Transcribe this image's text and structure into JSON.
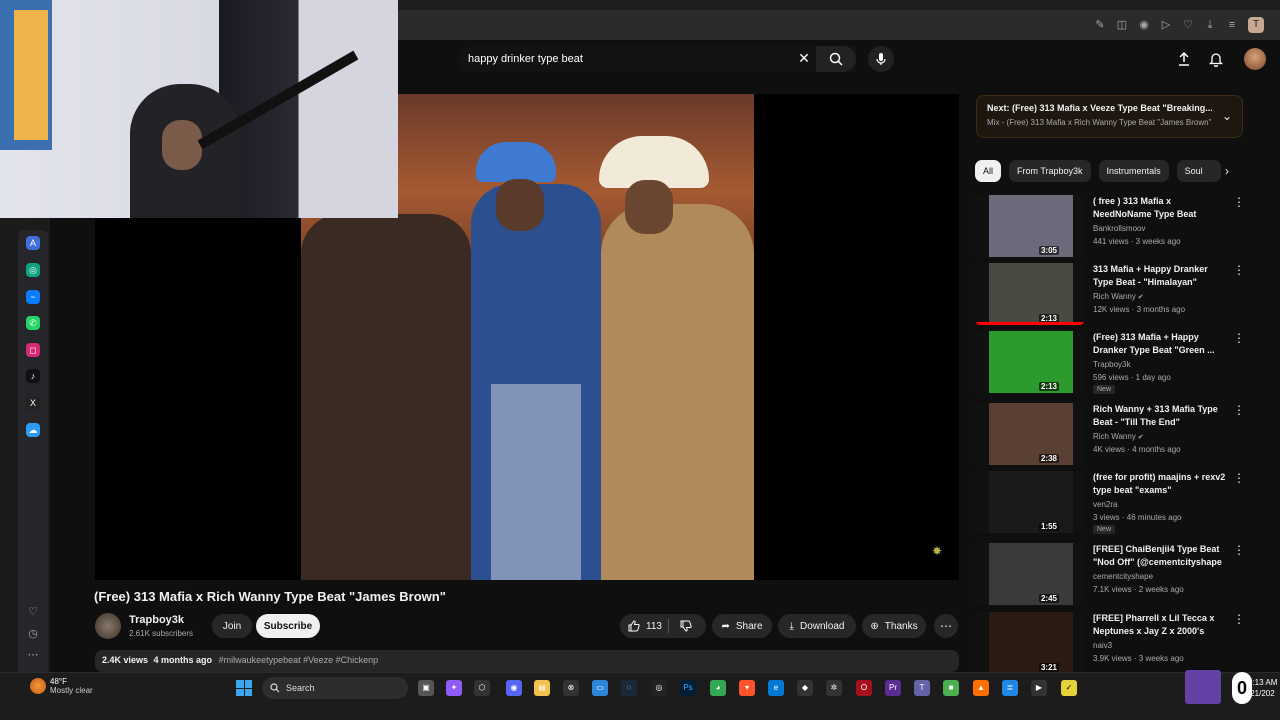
{
  "search": {
    "query": "happy drinker type beat"
  },
  "video": {
    "title": "(Free) 313 Mafia x Rich Wanny Type Beat \"James Brown\"",
    "channel": "Trapboy3k",
    "subscribers": "2.61K subscribers",
    "join_label": "Join",
    "subscribe_label": "Subscribe",
    "likes": "113",
    "share_label": "Share",
    "download_label": "Download",
    "thanks_label": "Thanks",
    "views": "2.4K views",
    "age": "4 months ago",
    "tags": "#milwaukeetypebeat #Veeze #Chickenp"
  },
  "next": {
    "prefix": "Next:",
    "title": "(Free) 313 Mafia x Veeze Type Beat \"Breaking...",
    "mix": "Mix - (Free) 313 Mafia x Rich Wanny Type Beat \"James Brown\""
  },
  "chips": [
    "All",
    "From Trapboy3k",
    "Instrumentals",
    "Soul"
  ],
  "recommendations": [
    {
      "title": "( free ) 313 Mafia x NeedNoName Type Beat",
      "channel": "Bankrollsmoov",
      "verified": false,
      "meta": "441 views · 3 weeks ago",
      "duration": "3:05",
      "badge": "",
      "progress": 0,
      "thumb": "#6a6a7a"
    },
    {
      "title": "313 Mafia + Happy Dranker Type Beat - \"Himalayan\"",
      "channel": "Rich Wanny",
      "verified": true,
      "meta": "12K views · 3 months ago",
      "duration": "2:13",
      "badge": "",
      "progress": 1.0,
      "thumb": "#4a4a42"
    },
    {
      "title": "(Free) 313 Mafia + Happy Dranker Type Beat \"Green ...",
      "channel": "Trapboy3k",
      "verified": false,
      "meta": "596 views · 1 day ago",
      "duration": "2:13",
      "badge": "New",
      "progress": 0,
      "thumb": "#2c9a2c"
    },
    {
      "title": "Rich Wanny + 313 Mafia Type Beat - \"Till The End\"",
      "channel": "Rich Wanny",
      "verified": true,
      "meta": "4K views · 4 months ago",
      "duration": "2:38",
      "badge": "",
      "progress": 0,
      "thumb": "#5a4034"
    },
    {
      "title": "(free for profit) maajins + rexv2 type beat \"exams\"",
      "channel": "ven2ra",
      "verified": false,
      "meta": "3 views · 46 minutes ago",
      "duration": "1:55",
      "badge": "New",
      "progress": 0,
      "thumb": "#1a1a1a"
    },
    {
      "title": "[FREE] ChaiBenjii4 Type Beat \"Nod Off\" (@cementcityshape ...",
      "channel": "cementcityshape",
      "verified": false,
      "meta": "7.1K views · 2 weeks ago",
      "duration": "2:45",
      "badge": "",
      "progress": 0,
      "thumb": "#3a3a3a"
    },
    {
      "title": "[FREE] Pharrell x Lil Tecca x Neptunes x Jay Z x 2000's Typ...",
      "channel": "naiv3",
      "verified": false,
      "meta": "3.9K views · 3 weeks ago",
      "duration": "3:21",
      "badge": "",
      "progress": 0,
      "thumb": "#2a1a12"
    }
  ],
  "taskbar": {
    "temperature": "48°F",
    "weather": "Mostly clear",
    "search_label": "Search",
    "time": "2:13 AM",
    "date": "/21/202"
  },
  "colors": {
    "accent_red": "#ff0000",
    "subscribe_bg": "#f1f1f1",
    "next_border": "#3d2b14",
    "twitch": "#6441a5"
  }
}
